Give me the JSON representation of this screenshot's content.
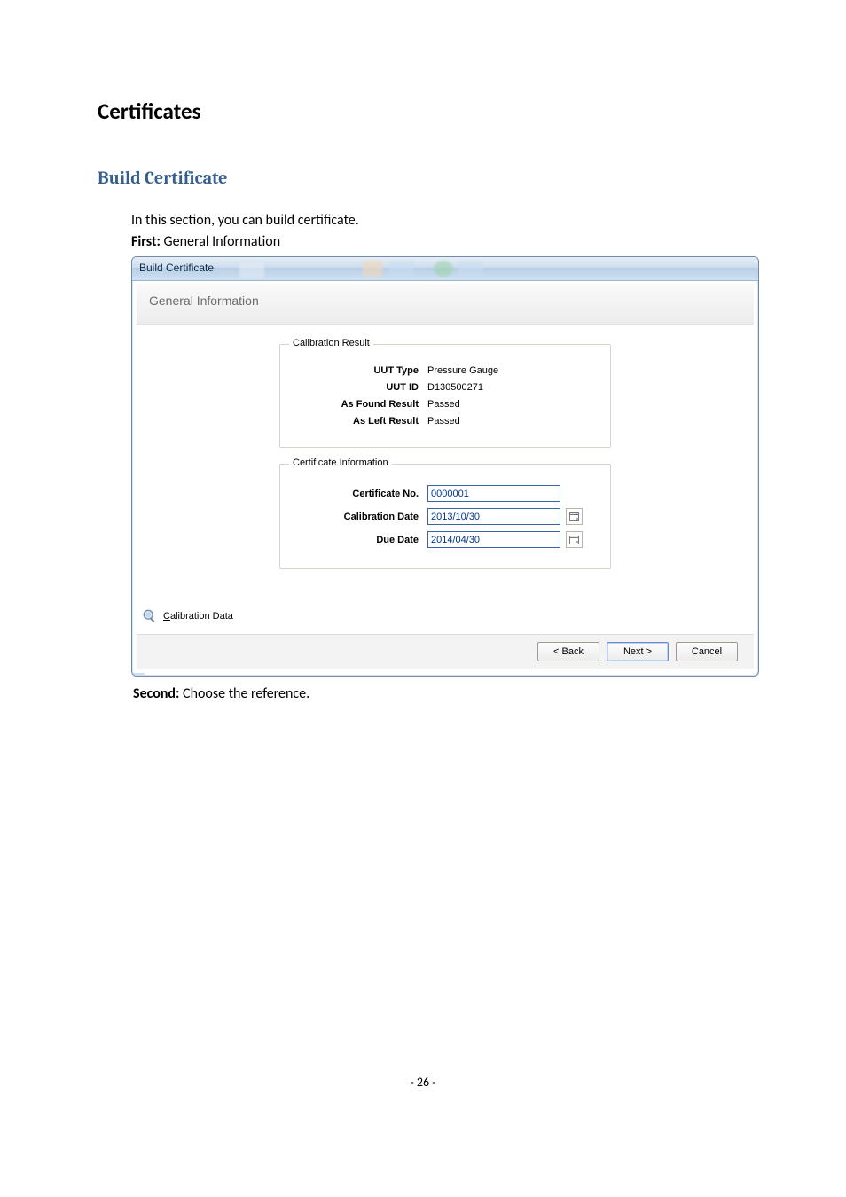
{
  "doc": {
    "title": "Certificates",
    "section": "Build Certificate",
    "line1": "In this section, you can build certificate.",
    "first_label": "First:",
    "first_text": " General Information",
    "second_label": "Second:",
    "second_text": " Choose the reference.",
    "page_number": "- 26 -"
  },
  "dialog": {
    "title": "Build Certificate",
    "heading": "General Information",
    "calibration_result": {
      "legend": "Calibration Result",
      "uut_type_label": "UUT Type",
      "uut_type_value": "Pressure Gauge",
      "uut_id_label": "UUT ID",
      "uut_id_value": "D130500271",
      "as_found_label": "As Found Result",
      "as_found_value": "Passed",
      "as_left_label": "As Left Result",
      "as_left_value": "Passed"
    },
    "cert_info": {
      "legend": "Certificate Information",
      "cert_no_label": "Certificate No.",
      "cert_no_value": "0000001",
      "cal_date_label": "Calibration Date",
      "cal_date_value": "2013/10/30",
      "due_date_label": "Due Date",
      "due_date_value": "2014/04/30"
    },
    "calibration_data_link": "Calibration Data",
    "calibration_data_accesskey_prefix": "C",
    "calibration_data_rest": "alibration Data",
    "buttons": {
      "back": "< Back",
      "next": "Next >",
      "cancel": "Cancel"
    }
  }
}
